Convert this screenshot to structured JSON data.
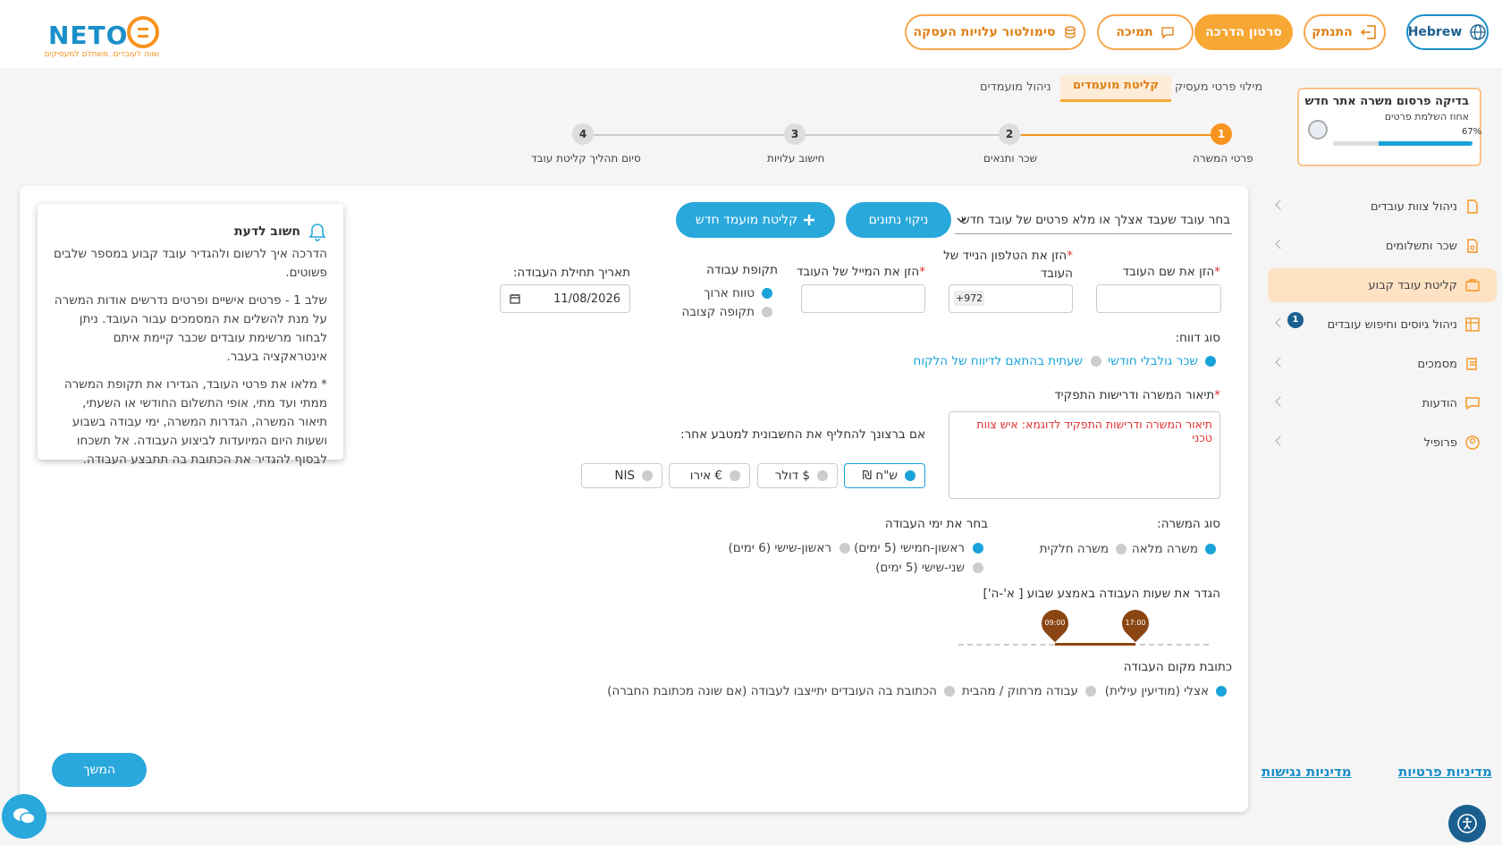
{
  "brand": {
    "logo_text": "NETO",
    "tagline": "שווה לעובדים. משתלם למעסיקים"
  },
  "header": {
    "simulator_label": "סימולטור עלויות העסקה",
    "support_label": "תמיכה",
    "tutorial_label": "סרטון הדרכה",
    "logout_label": "התנתק",
    "language_label": "Hebrew"
  },
  "tabs": [
    {
      "label": "מילוי פרטי מעסיק"
    },
    {
      "label": "קליטת מועמדים"
    },
    {
      "label": "ניהול מועמדים"
    }
  ],
  "steps": [
    {
      "number": "1",
      "label": "פרטי המשרה"
    },
    {
      "number": "2",
      "label": "שכר ותנאים"
    },
    {
      "number": "3",
      "label": "חישוב עלויות"
    },
    {
      "number": "4",
      "label": "סיום תהליך קליטת עובד"
    }
  ],
  "progress_card": {
    "title": "בדיקה פרסום משרה אתר חדש",
    "subtitle": "אחוז השלמת פרטים",
    "percent_label": "67%",
    "percent": 67
  },
  "sidebar": {
    "items": [
      {
        "label": "ניהול צוות עובדים"
      },
      {
        "label": "שכר ותשלומים"
      },
      {
        "label": "קליטת עובד קבוע"
      },
      {
        "label": "ניהול גיוסים וחיפוש עובדים",
        "badge": "1"
      },
      {
        "label": "מסמכים"
      },
      {
        "label": "הודעות"
      },
      {
        "label": "פרופיל"
      }
    ]
  },
  "footer": {
    "privacy_label": "מדיניות פרטיות",
    "accessibility_label": "מדיניות נגישות"
  },
  "form": {
    "employee_select": "בחר עובד שעבד אצלך או מלא פרטים של עובד חדש",
    "clear_button": "ניקוי נתונים",
    "new_candidate_button": "קליטת מועמד חדש",
    "name_label": "הזן את שם העובד",
    "phone_label_line1": "הזן את הטלפון הנייד של",
    "phone_label_line2": "העובד",
    "phone_prefix": "+972",
    "email_label": "הזן את המייל של העובד",
    "period_label": "תקופת עבודה",
    "period_options": [
      "טווח ארוך",
      "תקופה קצובה"
    ],
    "start_date_label": "תאריך תחילת העבודה:",
    "start_date_value": "11/08/2026",
    "report_type_label": "סוג דווח:",
    "report_options": [
      "שכר גולבלי חודשי",
      "שעתית בהתאם לדיווח של הלקוח"
    ],
    "job_desc_label": "תיאור המשרה ודרישות התפקיד",
    "job_desc_placeholder": "תיאור המשרה ודרישות התפקיד לדוגמא: איש צוות טכני",
    "currency_label": "אם ברצונך להחליף את החשבונית למטבע אחר:",
    "currencies": [
      "ש\"ח ₪",
      "$ דולר",
      "€ אירו",
      "NIS"
    ],
    "position_type_label": "סוג המשרה:",
    "position_options": [
      "משרה מלאה",
      "משרה חלקית"
    ],
    "workdays_label": "בחר את ימי העבודה",
    "workday_options": [
      "ראשון-חמישי (5 ימים)",
      "ראשון-שישי (6 ימים)",
      "שני-שישי (5 ימים)"
    ],
    "hours_label": "הגדר את שעות העבודה באמצע שבוע [ א'-ה']",
    "hours_start": "09:00",
    "hours_end": "17:00",
    "address_label": "כתובת מקום העבודה",
    "address_options": [
      "אצלי (מודיעין עילית)",
      "עבודה מרחוק / מהבית",
      "הכתובת בה העובדים יתייצבו לעבודה (אם שונה מכתובת החברה)"
    ],
    "continue_button": "המשך"
  },
  "notice": {
    "title": "חשוב לדעת",
    "p1": "הדרכה איך לרשום ולהגדיר עובד קבוע במספר שלבים פשוטים.",
    "p2": "שלב 1 - פרטים אישיים ופרטים נדרשים אודות המשרה על מנת להשלים את המסמכים עבור העובד. ניתן לבחור מרשימת עובדים שכבר קיימת איתם אינטראקציה בעבר.",
    "p3": "* מלאו את פרטי העובד, הגדירו את תקופת המשרה ממתי ועד מתי, אופי התשלום החודשי או השעתי, תיאור המשרה, הגדרות המשרה, ימי עבודה בשבוע ושעות היום המיועדות לביצוע העבודה. אל תשכחו לבסוף להגדיר את הכתובת בה תתבצע העבודה."
  },
  "colors": {
    "accent_orange": "#f7a733",
    "accent_blue": "#29a8dc",
    "pin_brown": "#8b4513"
  }
}
